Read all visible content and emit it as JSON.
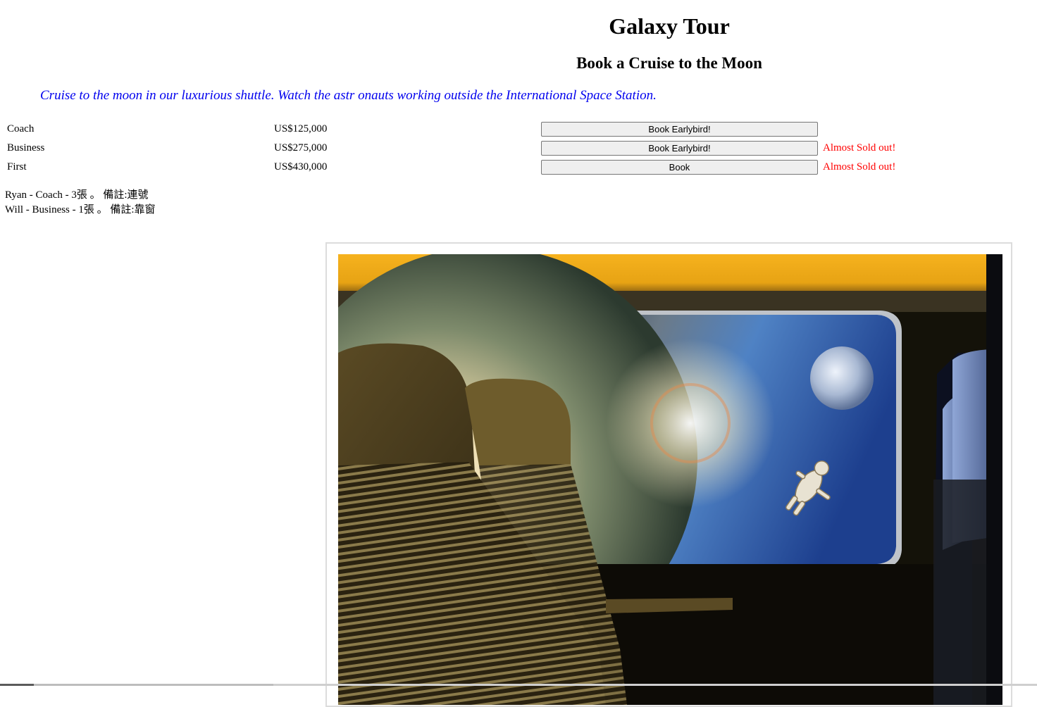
{
  "header": {
    "title": "Galaxy Tour",
    "subtitle": "Book a Cruise to the Moon",
    "tagline": "Cruise to the moon in our luxurious shuttle. Watch the astr onauts working outside the International Space Station."
  },
  "fares": [
    {
      "class": "Coach",
      "price": "US$125,000",
      "button": "Book Earlybird!",
      "note": ""
    },
    {
      "class": "Business",
      "price": "US$275,000",
      "button": "Book Earlybird!",
      "note": "Almost Sold out!"
    },
    {
      "class": "First",
      "price": "US$430,000",
      "button": "Book",
      "note": "Almost Sold out!"
    }
  ],
  "orders": [
    "Ryan - Coach - 3張 。 備註:連號",
    "Will - Business - 1張 。 備註:靠窗"
  ],
  "colors": {
    "tagline": "#0000ee",
    "sold_out_note": "#ff0000"
  },
  "icons": {
    "hero_image": "shuttle-cabin-window-space-image"
  }
}
